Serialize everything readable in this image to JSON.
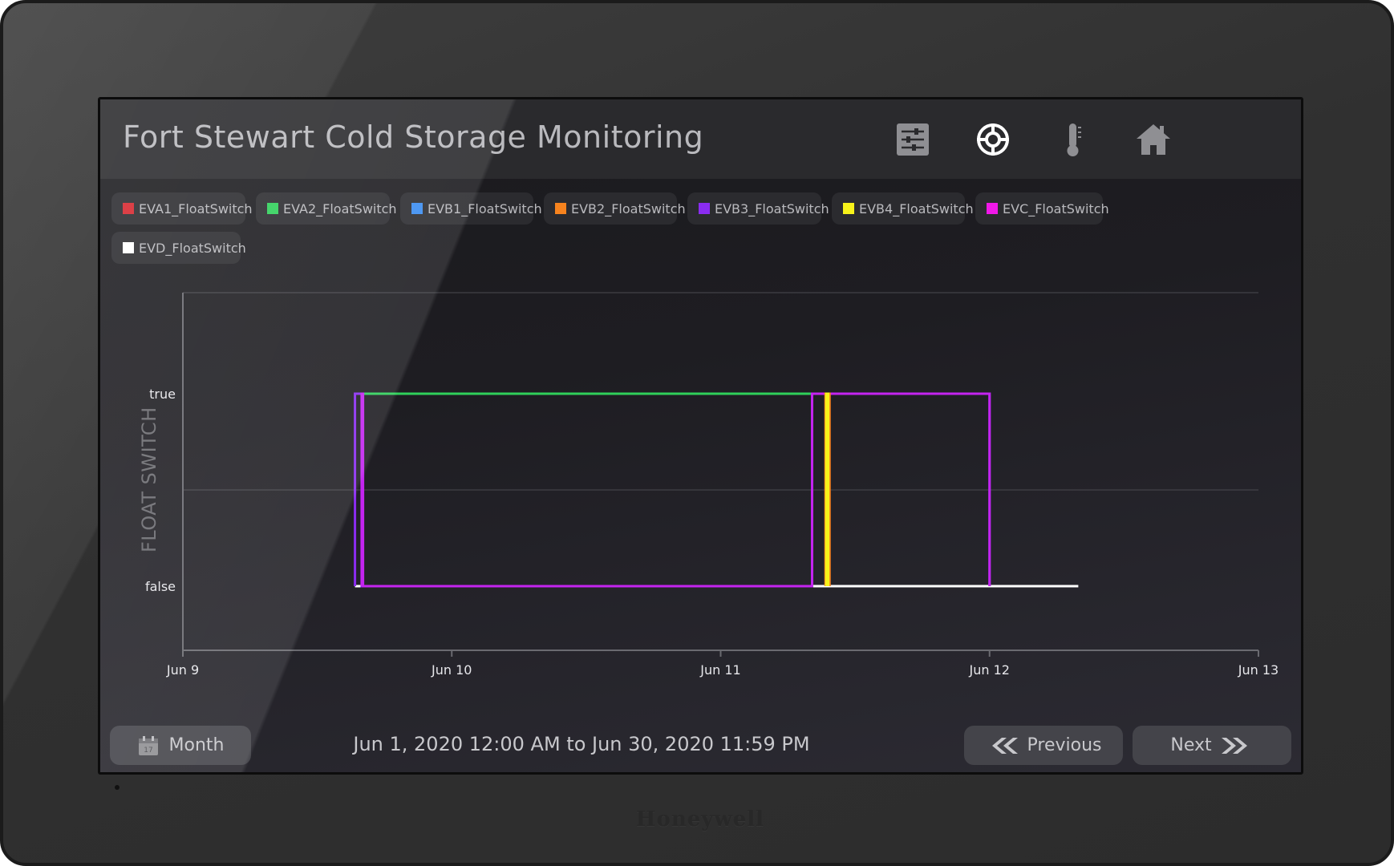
{
  "header": {
    "title": "Fort Stewart Cold Storage Monitoring",
    "nav": [
      {
        "name": "settings-sliders-icon"
      },
      {
        "name": "target-icon"
      },
      {
        "name": "thermometer-icon"
      },
      {
        "name": "home-icon"
      }
    ]
  },
  "legend": [
    {
      "label": "EVA1_FloatSwitch",
      "color": "#d7262e"
    },
    {
      "label": "EVA2_FloatSwitch",
      "color": "#2fd05a"
    },
    {
      "label": "EVB1_FloatSwitch",
      "color": "#3a8cf0"
    },
    {
      "label": "EVB2_FloatSwitch",
      "color": "#f7831e"
    },
    {
      "label": "EVB3_FloatSwitch",
      "color": "#8a2cf0"
    },
    {
      "label": "EVB4_FloatSwitch",
      "color": "#f7f21a"
    },
    {
      "label": "EVC_FloatSwitch",
      "color": "#f018e8"
    },
    {
      "label": "EVD_FloatSwitch",
      "color": "#ffffff"
    }
  ],
  "chart_data": {
    "type": "line",
    "ylabel": "FLOAT SWITCH",
    "y_categories": [
      "false",
      "true"
    ],
    "x_ticks": [
      "Jun 9",
      "Jun 10",
      "Jun 11",
      "Jun 12",
      "Jun 13"
    ],
    "x_unit": "days since Jun 9",
    "xlim": [
      0,
      4
    ],
    "series": [
      {
        "name": "EVD_FloatSwitch",
        "color": "#ffffff",
        "points": [
          [
            0.64,
            0
          ],
          [
            3.33,
            0
          ]
        ]
      },
      {
        "name": "EVA2_FloatSwitch",
        "color": "#2fd05a",
        "points": [
          [
            0.64,
            1
          ],
          [
            2.34,
            1
          ]
        ]
      },
      {
        "name": "EVB3_FloatSwitch",
        "color": "#8a2cf0",
        "points": [
          [
            0.64,
            0
          ],
          [
            0.64,
            1
          ],
          [
            0.665,
            1
          ],
          [
            0.665,
            0
          ],
          [
            2.34,
            0
          ],
          [
            2.34,
            1
          ],
          [
            3.0,
            1
          ],
          [
            3.0,
            0
          ]
        ]
      },
      {
        "name": "EVC_FloatSwitch",
        "color": "#c424f0",
        "points": [
          [
            0.665,
            0
          ],
          [
            0.665,
            1
          ],
          [
            0.67,
            1
          ],
          [
            0.67,
            0
          ],
          [
            2.34,
            0
          ],
          [
            2.34,
            1
          ],
          [
            3.0,
            1
          ],
          [
            3.0,
            0
          ]
        ]
      },
      {
        "name": "EVB2_FloatSwitch",
        "color": "#f7831e",
        "points": [
          [
            2.39,
            0
          ],
          [
            2.39,
            1
          ],
          [
            2.405,
            1
          ],
          [
            2.405,
            0
          ]
        ]
      },
      {
        "name": "EVB4_FloatSwitch",
        "color": "#f7f21a",
        "points": [
          [
            2.393,
            0
          ],
          [
            2.393,
            1
          ],
          [
            2.4,
            1
          ],
          [
            2.4,
            0
          ]
        ]
      }
    ]
  },
  "footer": {
    "month_label": "Month",
    "calendar_icon": "calendar-icon",
    "date_range": "Jun 1, 2020 12:00 AM to Jun 30, 2020 11:59 PM",
    "previous_label": "Previous",
    "next_label": "Next"
  },
  "brand": "Honeywell"
}
